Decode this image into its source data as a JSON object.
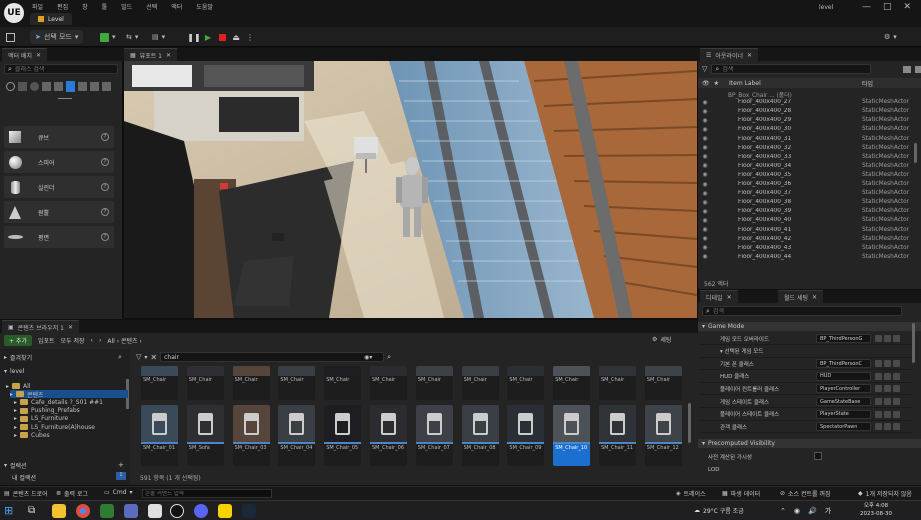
{
  "app": {
    "logo_text": "UE",
    "menus": [
      "파일",
      "편집",
      "창",
      "툴",
      "빌드",
      "선택",
      "액터",
      "도움말"
    ],
    "project_tab": "Level",
    "window_title": "level",
    "window_controls": [
      "—",
      "□",
      "✕"
    ]
  },
  "toolbar": {
    "save_icon": "save-icon",
    "mode_label": "선택 모드",
    "add_label": "+",
    "play_icons": [
      "pause",
      "play",
      "stop",
      "eject"
    ],
    "settings_label": "⚙"
  },
  "place_actors": {
    "tab_title": "액터 배치",
    "search_placeholder": "클래스 검색",
    "items": [
      {
        "label": "큐브",
        "shape": "cube"
      },
      {
        "label": "스피어",
        "shape": "sphere"
      },
      {
        "label": "실린더",
        "shape": "cylinder"
      },
      {
        "label": "원뿔",
        "shape": "cone"
      },
      {
        "label": "평면",
        "shape": "plane"
      }
    ],
    "help_glyph": "?"
  },
  "viewport": {
    "tab_title": "뷰포트 1"
  },
  "outliner": {
    "tab_title": "아웃라이너",
    "search_placeholder": "검색",
    "col_name": "Item Label",
    "col_type": "타입",
    "folder_row": "BP_Box_Chair ... (폴더)",
    "rows": [
      {
        "name": "Floor_400x400_27",
        "type": "StaticMeshActor"
      },
      {
        "name": "Floor_400x400_28",
        "type": "StaticMeshActor"
      },
      {
        "name": "Floor_400x400_29",
        "type": "StaticMeshActor"
      },
      {
        "name": "Floor_400x400_30",
        "type": "StaticMeshActor"
      },
      {
        "name": "Floor_400x400_31",
        "type": "StaticMeshActor"
      },
      {
        "name": "Floor_400x400_32",
        "type": "StaticMeshActor"
      },
      {
        "name": "Floor_400x400_33",
        "type": "StaticMeshActor"
      },
      {
        "name": "Floor_400x400_34",
        "type": "StaticMeshActor"
      },
      {
        "name": "Floor_400x400_35",
        "type": "StaticMeshActor"
      },
      {
        "name": "Floor_400x400_36",
        "type": "StaticMeshActor"
      },
      {
        "name": "Floor_400x400_37",
        "type": "StaticMeshActor"
      },
      {
        "name": "Floor_400x400_38",
        "type": "StaticMeshActor"
      },
      {
        "name": "Floor_400x400_39",
        "type": "StaticMeshActor"
      },
      {
        "name": "Floor_400x400_40",
        "type": "StaticMeshActor"
      },
      {
        "name": "Floor_400x400_41",
        "type": "StaticMeshActor"
      },
      {
        "name": "Floor_400x400_42",
        "type": "StaticMeshActor"
      },
      {
        "name": "Floor_400x400_43",
        "type": "StaticMeshActor"
      },
      {
        "name": "Floor_400x400_44",
        "type": "StaticMeshActor"
      }
    ],
    "footer": "562 액터"
  },
  "details": {
    "tab_title": "디테일",
    "tab2_title": "월드 세팅",
    "search_placeholder": "검색",
    "section1": "Game Mode",
    "section2": "Precomputed Visibility",
    "rows": [
      {
        "label": "게임 모드 오버라이드",
        "value": "BP_ThirdPersonG"
      },
      {
        "label": "▾ 선택된 게임 모드",
        "value": ""
      },
      {
        "label": "기본 폰 클래스",
        "value": "BP_ThirdPersonC"
      },
      {
        "label": "HUD 클래스",
        "value": "HUD"
      },
      {
        "label": "플레이어 컨트롤러 클래스",
        "value": "PlayerController"
      },
      {
        "label": "게임 스테이트 클래스",
        "value": "GameStateBase"
      },
      {
        "label": "플레이어 스테이트 클래스",
        "value": "PlayerState"
      },
      {
        "label": "관객 클래스",
        "value": "SpectatorPawn"
      }
    ],
    "vis_row": "사전 계산된 가시성",
    "lod_row": "LOD"
  },
  "content_browser": {
    "tab_title": "콘텐츠 브라우저 1",
    "tab2_title": "출력 로그",
    "add_label": "+ 추가",
    "import_label": "임포트",
    "save_all_label": "모두 저장",
    "path": "All › 콘텐츠 ›",
    "settings_label": "세팅",
    "favorites_label": "즐겨찾기",
    "root_label": "level",
    "search_placeholder": "chair",
    "tree": [
      "All",
      "콘텐츠",
      "Cafe_details ?_S01 ##1",
      "Pushing_Prefabs",
      "LS_Furniture",
      "LS_Furniture(A)house",
      "Cubes"
    ],
    "collections_label": "컬렉션",
    "collections_sub": "내 컬렉션",
    "collections_count": "1",
    "status": "591 항목 (1 개 선택됨)",
    "assets_top": [
      "SM_Chair",
      "SM_Chair",
      "SM_Chair",
      "SM_Chair",
      "SM_Chair",
      "SM_Chair",
      "SM_Chair",
      "SM_Chair",
      "SM_Chair",
      "SM_Chair",
      "SM_Chair",
      "SM_Chair"
    ],
    "assets_bottom": [
      "SM_Chair_01",
      "SM_Sofa",
      "SM_Chair_03",
      "SM_Chair_04",
      "SM_Chair_05",
      "SM_Chair_06",
      "SM_Chair_07",
      "SM_Chair_08",
      "SM_Chair_09",
      "SM_Chair_10",
      "SM_Chair_11",
      "SM_Chair_12"
    ]
  },
  "statusbar": {
    "content_drawer": "콘텐츠 드로어",
    "output_log": "출력 로그",
    "cmd": "Cmd",
    "console_placeholder": "콘솔 커맨드 입력",
    "trace": "트레이스",
    "derived": "파생 데이터",
    "source_control": "소스 컨트롤 꺼짐",
    "unsaved": "1개 저장되지 않음"
  },
  "taskbar": {
    "weather": "29°C 구름 조금",
    "time": "오후 4:08",
    "date": "2023-08-30"
  },
  "colors": {
    "accent": "#1a6fcf",
    "stop_red": "#e02020",
    "play_green": "#3fa83f",
    "folder": "#c8a24a"
  }
}
